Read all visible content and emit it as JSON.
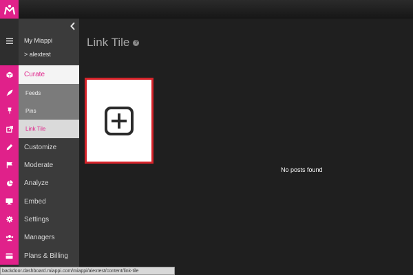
{
  "header": {
    "logo_icon": "miappi-logo-icon",
    "brand_color": "#e0218a"
  },
  "sidebar": {
    "account_title": "My Miappi",
    "account_sub": "> alextest",
    "collapse_icon": "chevron-left-icon",
    "items": [
      {
        "label": "Curate",
        "icon": "cube-icon",
        "active": true
      },
      {
        "label": "Customize",
        "icon": "pencil-icon"
      },
      {
        "label": "Moderate",
        "icon": "flag-icon"
      },
      {
        "label": "Analyze",
        "icon": "pie-chart-icon"
      },
      {
        "label": "Embed",
        "icon": "monitor-icon"
      },
      {
        "label": "Settings",
        "icon": "gear-icon"
      },
      {
        "label": "Managers",
        "icon": "users-icon"
      },
      {
        "label": "Plans & Billing",
        "icon": "credit-card-icon"
      }
    ],
    "subitems": [
      {
        "label": "Feeds",
        "icon": "rocket-icon"
      },
      {
        "label": "Pins",
        "icon": "pin-icon"
      },
      {
        "label": "Link Tile",
        "icon": "external-link-icon",
        "selected": true
      }
    ]
  },
  "main": {
    "title": "Link Tile",
    "help": "?",
    "add_tile_icon": "plus-square-icon",
    "empty_message": "No posts found"
  },
  "statusbar": {
    "url": "backdoor.dashboard.miappi.com/miappi/alextest/content/link-tile"
  }
}
